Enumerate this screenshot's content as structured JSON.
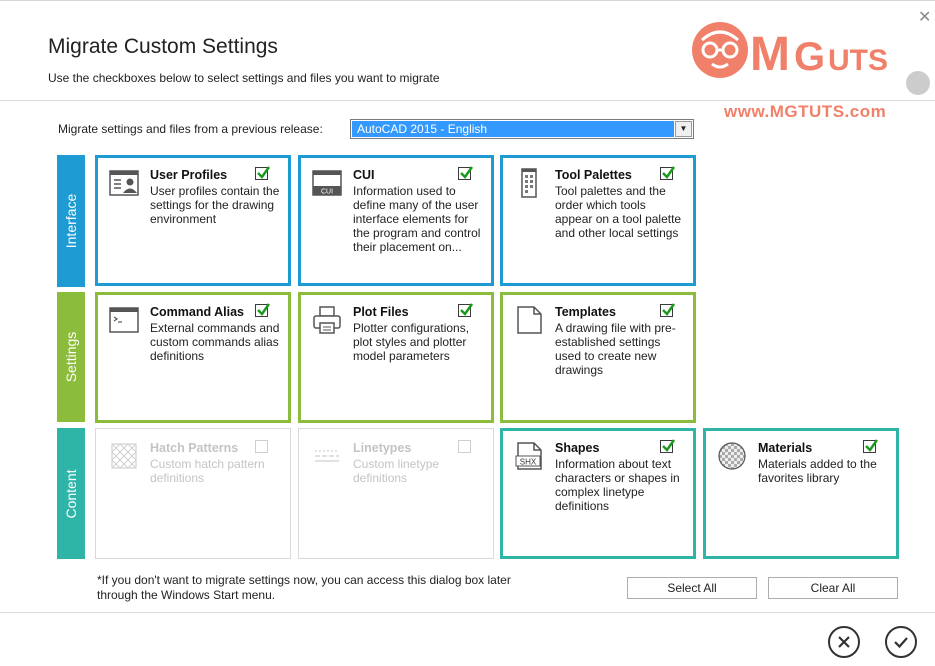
{
  "dialog": {
    "title": "Migrate Custom Settings",
    "subtitle": "Use the checkboxes below to select settings and files you want to migrate"
  },
  "watermark": {
    "brand": "MGUTS",
    "url": "www.MGTUTS.com"
  },
  "release": {
    "label": "Migrate settings and files from a previous release:",
    "selected": "AutoCAD 2015 - English"
  },
  "bands": {
    "interface": "Interface",
    "settings": "Settings",
    "content": "Content"
  },
  "cards": {
    "user_profiles": {
      "name": "User Profiles",
      "desc": "User profiles contain the settings for the drawing environment",
      "checked": true
    },
    "cui": {
      "name": "CUI",
      "desc": "Information used to define many of the user interface elements for the program and control their placement on...",
      "checked": true
    },
    "tool_palettes": {
      "name": "Tool Palettes",
      "desc": "Tool palettes and the order which tools appear on a tool palette and other local settings",
      "checked": true
    },
    "command_alias": {
      "name": "Command Alias",
      "desc": "External commands and custom commands alias definitions",
      "checked": true
    },
    "plot_files": {
      "name": "Plot Files",
      "desc": "Plotter configurations, plot styles and plotter model parameters",
      "checked": true
    },
    "templates": {
      "name": "Templates",
      "desc": "A drawing file with pre-established settings used to create new drawings",
      "checked": true
    },
    "hatch_patterns": {
      "name": "Hatch Patterns",
      "desc": "Custom hatch pattern definitions",
      "checked": false
    },
    "linetypes": {
      "name": "Linetypes",
      "desc": "Custom linetype definitions",
      "checked": false
    },
    "shapes": {
      "name": "Shapes",
      "desc": "Information about text characters or shapes in complex linetype definitions",
      "checked": true,
      "icon_text": "SHX"
    },
    "materials": {
      "name": "Materials",
      "desc": "Materials added to the favorites library",
      "checked": true
    }
  },
  "cui_icon_text": "CUI",
  "footer": {
    "note": "*If you don't want to migrate settings now, you can access this dialog box later through the Windows Start menu.",
    "select_all": "Select All",
    "clear_all": "Clear All"
  },
  "icons": {
    "close": "close-icon",
    "cancel": "cancel-circle-icon",
    "ok": "ok-circle-icon"
  },
  "colors": {
    "interface": "#1e9bd3",
    "settings": "#8cbc3c",
    "content": "#2fb5a8",
    "selection": "#3399ff",
    "checkmark": "#1a9a1a"
  }
}
